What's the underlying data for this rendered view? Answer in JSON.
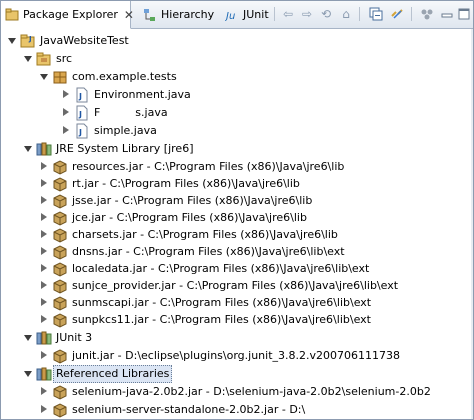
{
  "tabs": [
    {
      "label": "Package Explorer",
      "close": "✕"
    },
    {
      "label": "Hierarchy"
    },
    {
      "label": "JUnit"
    }
  ],
  "tree": {
    "project": "JavaWebsiteTest",
    "src": "src",
    "package": "com.example.tests",
    "files": [
      "Environment.java",
      "F          s.java",
      "simple.java"
    ],
    "jre": "JRE System Library [jre6]",
    "jre_jars": [
      "resources.jar - C:\\Program Files (x86)\\Java\\jre6\\lib",
      "rt.jar - C:\\Program Files (x86)\\Java\\jre6\\lib",
      "jsse.jar - C:\\Program Files (x86)\\Java\\jre6\\lib",
      "jce.jar - C:\\Program Files (x86)\\Java\\jre6\\lib",
      "charsets.jar - C:\\Program Files (x86)\\Java\\jre6\\lib",
      "dnsns.jar - C:\\Program Files (x86)\\Java\\jre6\\lib\\ext",
      "localedata.jar - C:\\Program Files (x86)\\Java\\jre6\\lib\\ext",
      "sunjce_provider.jar - C:\\Program Files (x86)\\Java\\jre6\\lib\\ext",
      "sunmscapi.jar - C:\\Program Files (x86)\\Java\\jre6\\lib\\ext",
      "sunpkcs11.jar - C:\\Program Files (x86)\\Java\\jre6\\lib\\ext"
    ],
    "junit": "JUnit 3",
    "junit_jar": "junit.jar - D:\\eclipse\\plugins\\org.junit_3.8.2.v200706111738",
    "ref_libs": "Referenced Libraries",
    "ref_jars": [
      "selenium-java-2.0b2.jar - D:\\selenium-java-2.0b2\\selenium-2.0b2",
      "selenium-server-standalone-2.0b2.jar - D:\\"
    ]
  }
}
